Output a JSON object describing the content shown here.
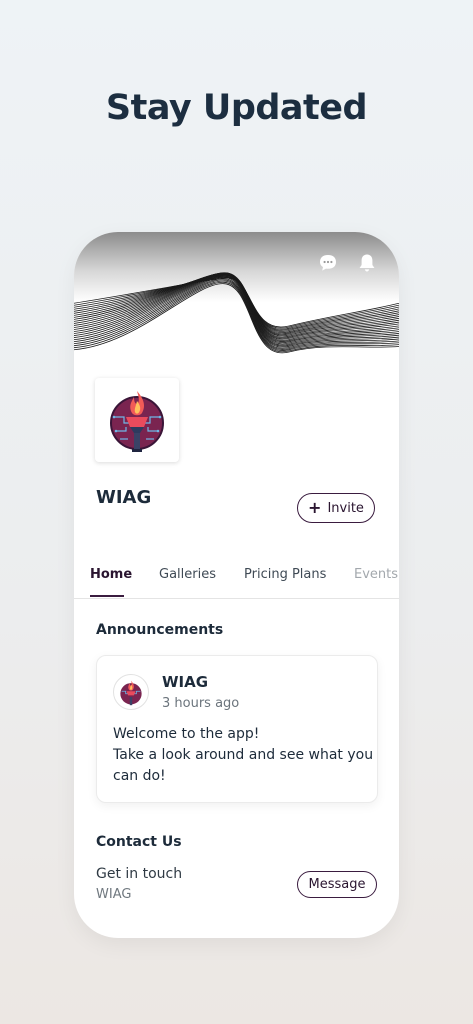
{
  "headline": "Stay Updated",
  "top_icons": [
    "chat-bubble-icon",
    "bell-icon"
  ],
  "group": {
    "name": "WIAG",
    "logo": "torch-logo"
  },
  "invite_button": {
    "icon": "plus-icon",
    "label": "Invite"
  },
  "tabs": [
    {
      "label": "Home",
      "active": true
    },
    {
      "label": "Galleries",
      "active": false
    },
    {
      "label": "Pricing Plans",
      "active": false
    },
    {
      "label": "Events",
      "active": false
    }
  ],
  "announcements": {
    "title": "Announcements",
    "post": {
      "author": "WIAG",
      "time": "3 hours ago",
      "lines": [
        "Welcome to the app!",
        "Take a look around and see what you",
        "can do!"
      ]
    }
  },
  "contact": {
    "title": "Contact Us",
    "label": "Get in touch",
    "sub": "WIAG",
    "button_label": "Message"
  },
  "colors": {
    "accent": "#3a1c3f",
    "headline": "#1c2e40",
    "torch_flame": "#e8485a",
    "torch_body": "#8a2f5a",
    "circuit": "#2a5a8a"
  }
}
